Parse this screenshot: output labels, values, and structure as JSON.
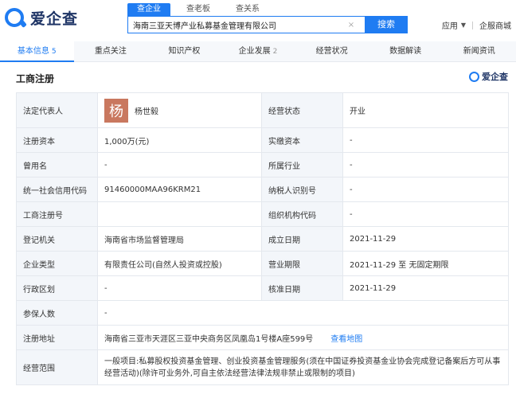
{
  "header": {
    "logo_text": "爱企查",
    "search_tabs": [
      "查企业",
      "查老板",
      "查关系"
    ],
    "search_value": "海南三亚天博产业私募基金管理有限公司",
    "search_button": "搜索",
    "apps_label": "应用",
    "mall_label": "企服商城"
  },
  "nav": {
    "tabs": [
      {
        "label": "基本信息",
        "count": "5"
      },
      {
        "label": "重点关注",
        "count": ""
      },
      {
        "label": "知识产权",
        "count": ""
      },
      {
        "label": "企业发展",
        "count": "2"
      },
      {
        "label": "经营状况",
        "count": ""
      },
      {
        "label": "数据解读",
        "count": ""
      },
      {
        "label": "新闻资讯",
        "count": ""
      }
    ]
  },
  "section": {
    "title": "工商注册",
    "brand": "爱企查"
  },
  "registration": {
    "legal_rep_label": "法定代表人",
    "legal_rep_avatar": "杨",
    "legal_rep_name": "杨世毅",
    "status_label": "经营状态",
    "status_value": "开业",
    "reg_capital_label": "注册资本",
    "reg_capital_value": "1,000万(元)",
    "paid_capital_label": "实缴资本",
    "paid_capital_value": "-",
    "former_name_label": "曾用名",
    "former_name_value": "-",
    "industry_label": "所属行业",
    "industry_value": "-",
    "credit_code_label": "统一社会信用代码",
    "credit_code_value": "91460000MAA96KRM21",
    "taxpayer_label": "纳税人识别号",
    "taxpayer_value": "-",
    "reg_number_label": "工商注册号",
    "reg_number_value": "",
    "org_code_label": "组织机构代码",
    "org_code_value": "-",
    "authority_label": "登记机关",
    "authority_value": "海南省市场监督管理局",
    "established_label": "成立日期",
    "established_value": "2021-11-29",
    "type_label": "企业类型",
    "type_value": "有限责任公司(自然人投资或控股)",
    "term_label": "营业期限",
    "term_value": "2021-11-29 至 无固定期限",
    "district_label": "行政区划",
    "district_value": "-",
    "approval_label": "核准日期",
    "approval_value": "2021-11-29",
    "insured_label": "参保人数",
    "insured_value": "-",
    "address_label": "注册地址",
    "address_value": "海南省三亚市天涯区三亚中央商务区凤凰岛1号楼A座599号",
    "map_link": "查看地图",
    "scope_label": "经营范围",
    "scope_value": "一般项目:私募股权投资基金管理、创业投资基金管理服务(须在中国证券投资基金业协会完成登记备案后方可从事经营活动)(除许可业务外,可自主依法经营法律法规非禁止或限制的项目)"
  }
}
